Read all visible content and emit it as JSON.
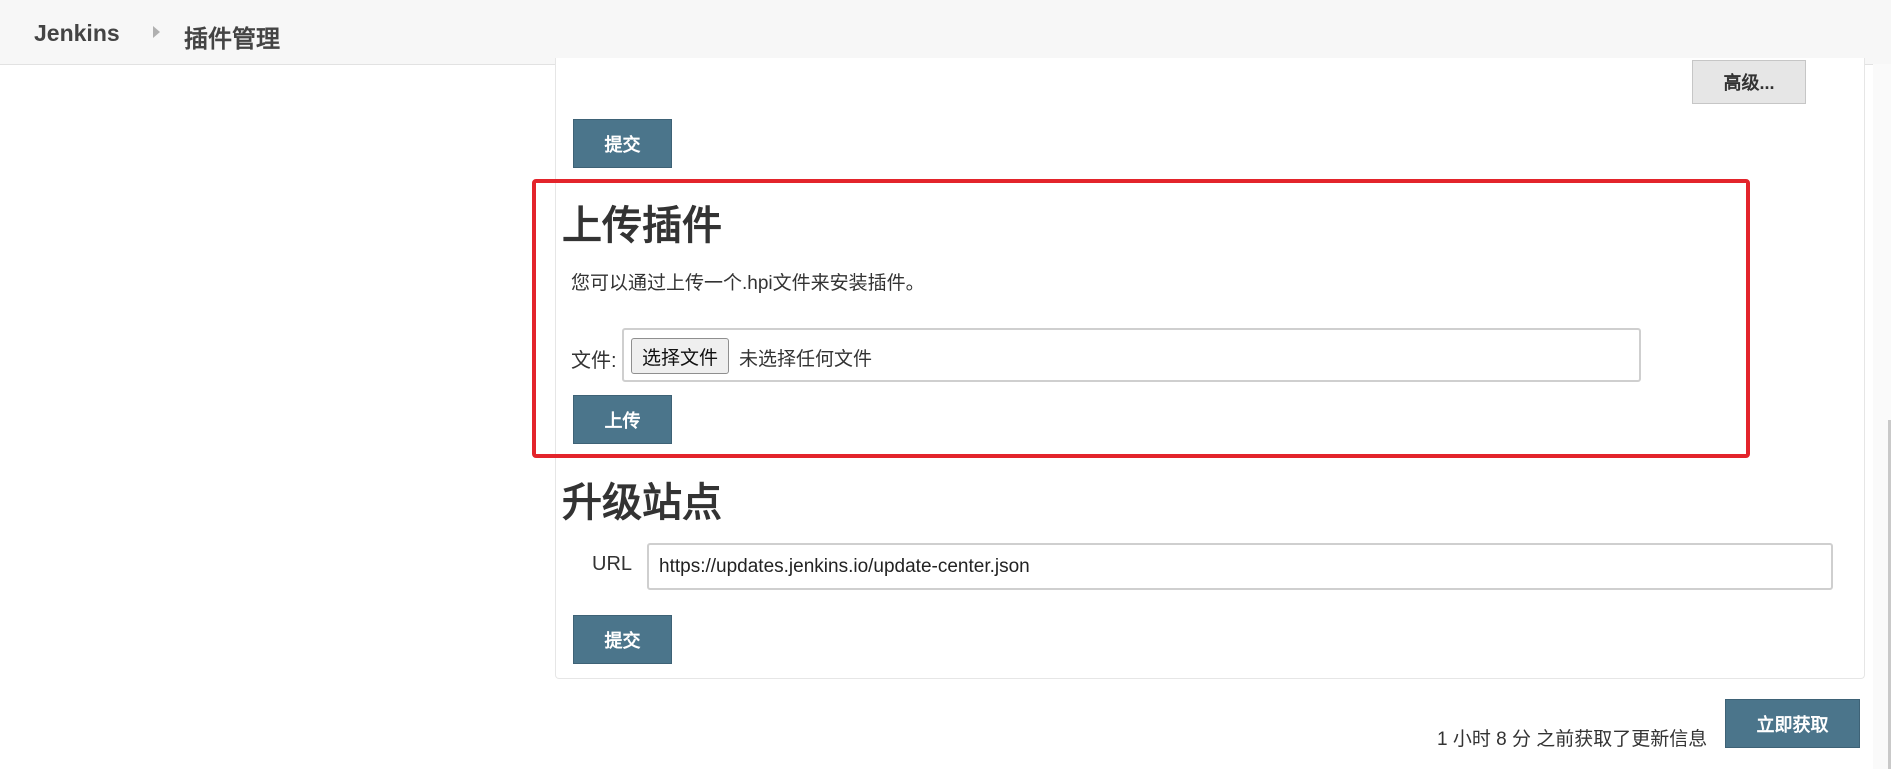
{
  "breadcrumb": {
    "home": "Jenkins",
    "current": "插件管理",
    "separator_icon": "chevron-right-icon"
  },
  "advanced": {
    "button_label": "高级..."
  },
  "proxy": {
    "submit_label": "提交"
  },
  "upload": {
    "title": "上传插件",
    "description": "您可以通过上传一个.hpi文件来安装插件。",
    "file_label": "文件:",
    "choose_file_label": "选择文件",
    "no_file_text": "未选择任何文件",
    "upload_label": "上传"
  },
  "update_site": {
    "title": "升级站点",
    "url_label": "URL",
    "url_value": "https://updates.jenkins.io/update-center.json",
    "submit_label": "提交"
  },
  "footer": {
    "status_text": "1 小时 8 分 之前获取了更新信息",
    "check_now_label": "立即获取"
  },
  "colors": {
    "primary_button": "#4b758b",
    "highlight_border": "#e3242b",
    "topbar_bg": "#f7f7f7"
  }
}
